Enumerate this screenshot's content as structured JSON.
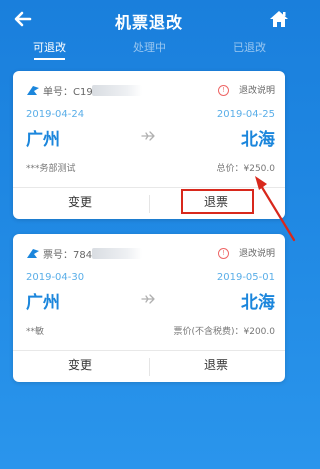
{
  "header": {
    "title": "机票退改"
  },
  "tabs": [
    {
      "label": "可退改",
      "active": true
    },
    {
      "label": "处理中",
      "active": false
    },
    {
      "label": "已退改",
      "active": false
    }
  ],
  "cards": [
    {
      "order_label": "单号：C19",
      "rules_link": "退改说明",
      "dep_date": "2019-04-24",
      "arr_date": "2019-04-25",
      "dep_city": "广州",
      "arr_city": "北海",
      "passenger": "***务部测试",
      "price": "总价：¥250.0",
      "change_label": "变更",
      "refund_label": "退票"
    },
    {
      "order_label": "票号：784",
      "rules_link": "退改说明",
      "dep_date": "2019-04-30",
      "arr_date": "2019-05-01",
      "dep_city": "广州",
      "arr_city": "北海",
      "passenger": "**敏",
      "price": "票价(不含税费)：¥200.0",
      "change_label": "变更",
      "refund_label": "退票"
    }
  ],
  "colors": {
    "background": "#1f87e2",
    "city": "#1b86dc",
    "date": "#5aaee8",
    "highlight": "#d8281c"
  },
  "icons": {
    "back": "arrow-left-icon",
    "home": "home-icon",
    "plane": "plane-icon",
    "info": "info-icon"
  }
}
